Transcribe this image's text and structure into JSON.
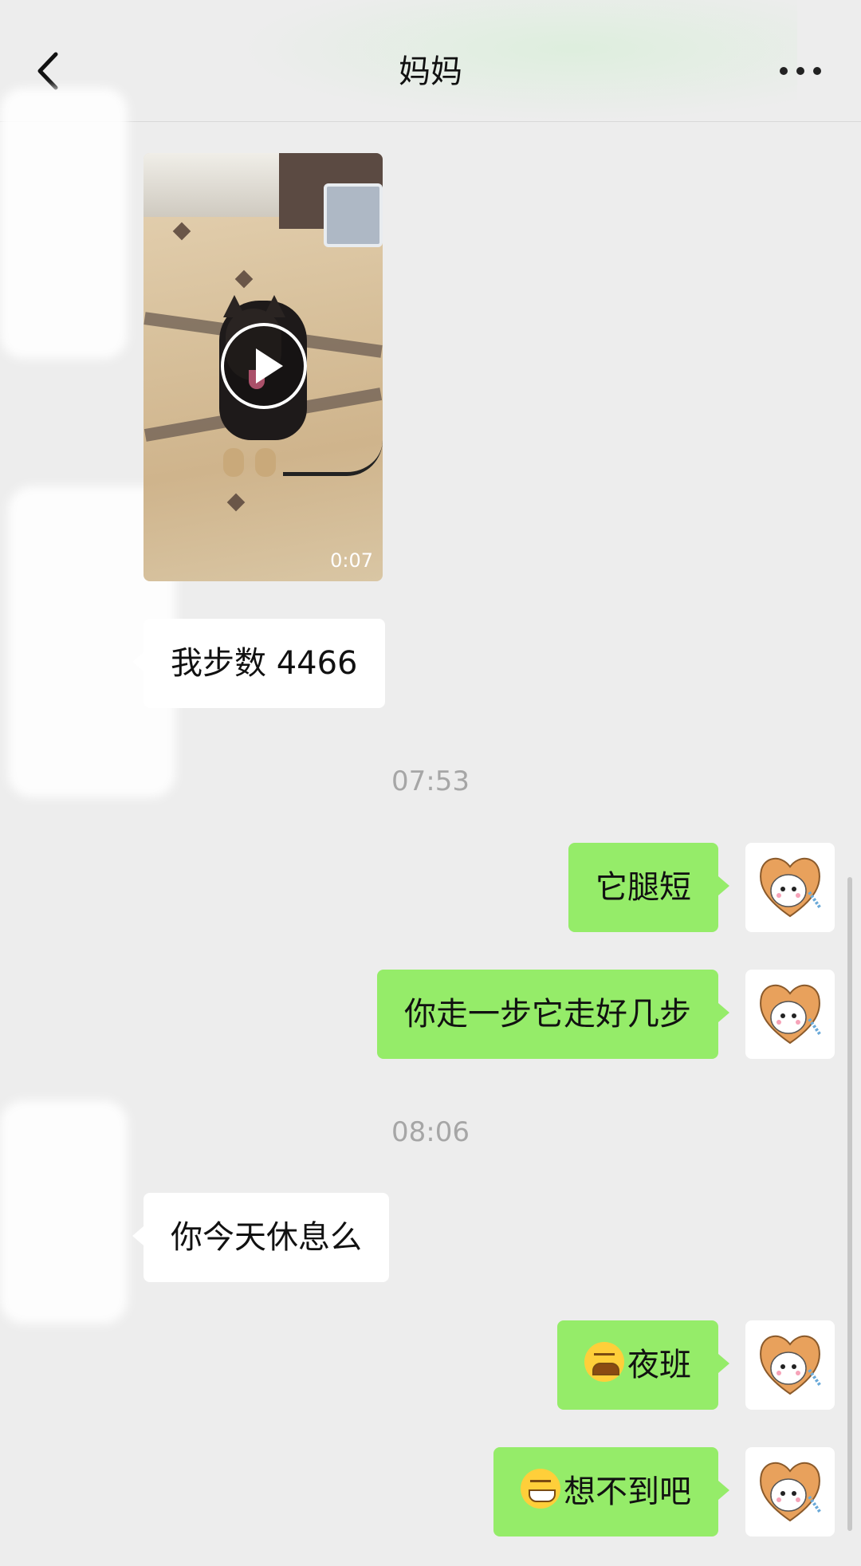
{
  "header": {
    "title": "妈妈"
  },
  "video": {
    "duration": "0:07"
  },
  "messages": [
    {
      "side": "in",
      "text": "我步数 4466"
    },
    {
      "type": "time",
      "text": "07:53"
    },
    {
      "side": "out",
      "text": "它腿短"
    },
    {
      "side": "out",
      "text": "你走一步它走好几步"
    },
    {
      "type": "time",
      "text": "08:06"
    },
    {
      "side": "in",
      "text": "你今天休息么"
    },
    {
      "side": "out",
      "emoji": "sob-emoji",
      "text": "夜班"
    },
    {
      "side": "out",
      "emoji": "grin-emoji",
      "text": "想不到吧"
    }
  ],
  "colors": {
    "outgoing_bubble": "#95ec69",
    "incoming_bubble": "#ffffff",
    "background": "#ededed"
  }
}
